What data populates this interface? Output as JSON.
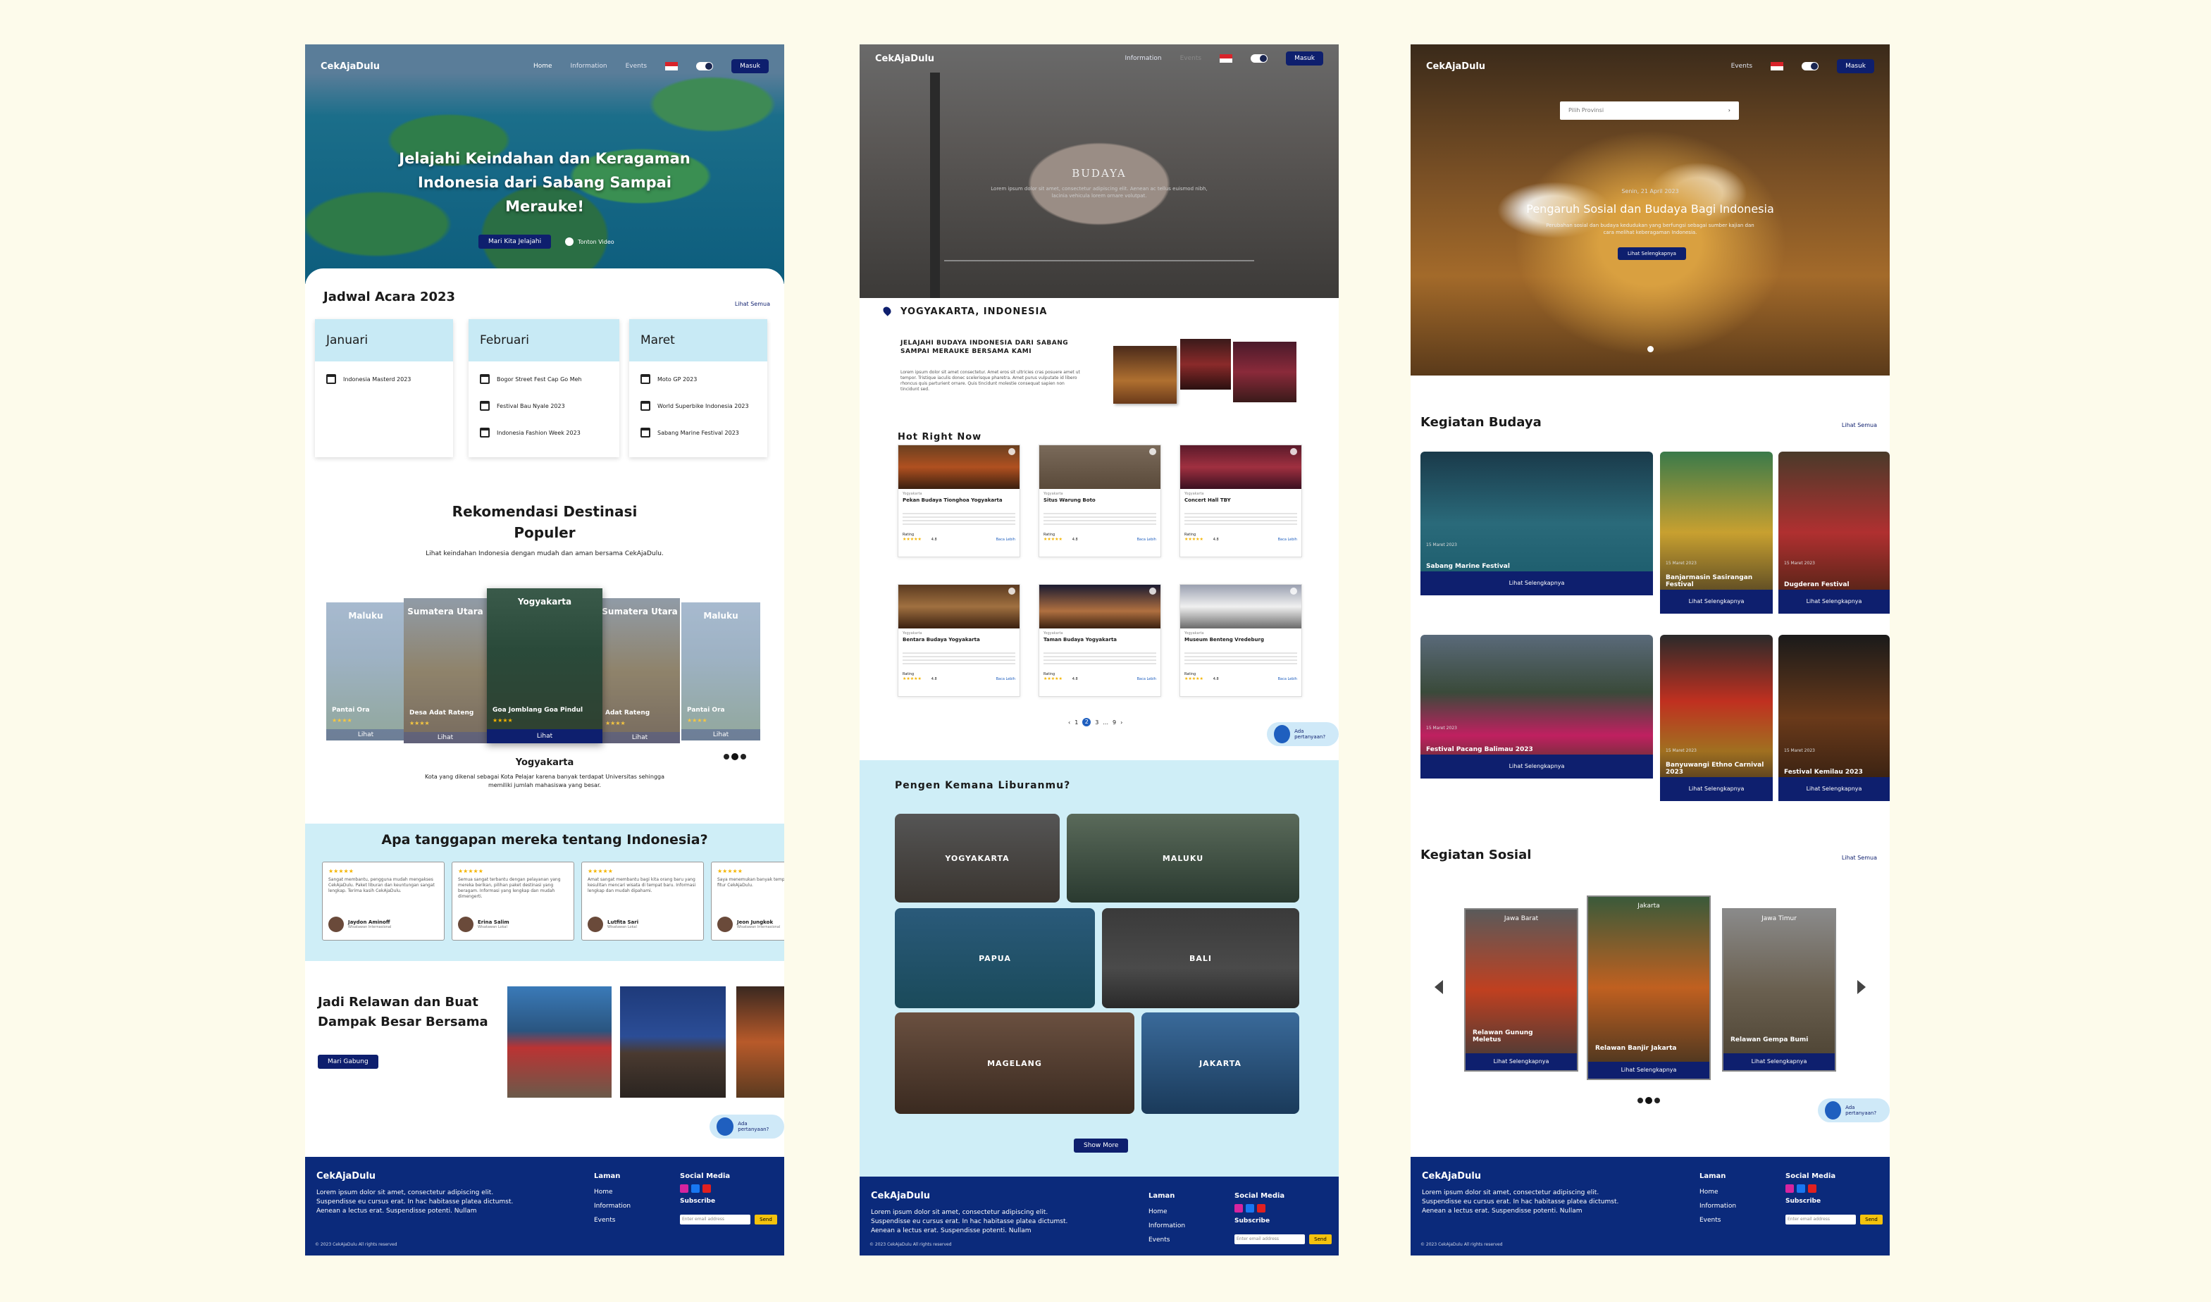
{
  "page1": {
    "nav": {
      "brand": "CekAjaDulu",
      "links": [
        "Home",
        "Information",
        "Events"
      ],
      "login": "Masuk"
    },
    "hero": {
      "title": "Jelajahi Keindahan dan Keragaman Indonesia dari Sabang Sampai Merauke!",
      "cta": "Mari Kita Jelajahi",
      "video": "Tonton Video"
    },
    "schedule": {
      "title": "Jadwal Acara 2023",
      "see_all": "Lihat Semua",
      "months": [
        {
          "name": "Januari",
          "events": [
            "Indonesia Masterd 2023"
          ]
        },
        {
          "name": "Februari",
          "events": [
            "Bogor Street Fest Cap Go Meh",
            "Festival Bau Nyale 2023",
            "Indonesia Fashion Week 2023"
          ]
        },
        {
          "name": "Maret",
          "events": [
            "Moto GP 2023",
            "World Superbike Indonesia 2023",
            "Sabang Marine Festival 2023"
          ]
        }
      ]
    },
    "reco": {
      "title": "Rekomendasi Destinasi Populer",
      "subtitle": "Lihat keindahan Indonesia dengan mudah dan aman bersama CekAjaDulu.",
      "cards": [
        {
          "region": "Maluku",
          "name": "Pantai Ora",
          "btn": "Lihat"
        },
        {
          "region": "Sumatera Utara",
          "name": "Desa Adat Rateng",
          "btn": "Lihat"
        },
        {
          "region": "Yogyakarta",
          "name": "Goa Jomblang Goa Pindul",
          "btn": "Lihat"
        },
        {
          "region": "Sumatera Utara",
          "name": "Adat Rateng",
          "btn": "Lihat"
        },
        {
          "region": "Maluku",
          "name": "Pantai Ora",
          "btn": "Lihat"
        }
      ],
      "selected": "Yogyakarta",
      "desc": "Kota yang dikenal sebagai Kota Pelajar karena banyak terdapat Universitas sehingga memiliki jumlah mahasiswa yang besar."
    },
    "testimonials": {
      "title": "Apa tanggapan mereka tentang Indonesia?",
      "items": [
        {
          "text": "Sangat membantu, pengguna mudah mengakses CekAjaDulu. Paket liburan dan keuntungan sangat lengkap. Terima kasih CekAjaDulu.",
          "name": "Jaydon Aminoff",
          "role": "Wisatawan Internasional"
        },
        {
          "text": "Semua sangat terbantu dengan pelayanan yang mereka berikan, pilihan paket destinasi yang beragam. Informasi yang lengkap dan mudah dimengerti.",
          "name": "Erina Salim",
          "role": "Wisatawan Lokal"
        },
        {
          "text": "Amat sangat membantu bagi kita orang baru yang kesulitan mencari wisata di tempat baru. Informasi lengkap dan mudah dipahami.",
          "name": "Lutfita Sari",
          "role": "Wisatawan Lokal"
        },
        {
          "text": "Saya menemukan banyak tempat menggunakan fitur CekAjaDulu.",
          "name": "Jeon Jungkok",
          "role": "Wisatawan Internasional"
        }
      ]
    },
    "volunteer": {
      "title": "Jadi Relawan dan Buat Dampak Besar Bersama",
      "cta": "Mari Gabung"
    },
    "chat": "Ada pertanyaan?",
    "footer": {
      "brand": "CekAjaDulu",
      "desc": "Lorem ipsum dolor sit amet, consectetur adipiscing elit. Suspendisse eu cursus erat. In hac habitasse platea dictumst. Aenean a lectus erat. Suspendisse potenti. Nullam",
      "lam_title": "Laman",
      "lam": [
        "Home",
        "Information",
        "Events"
      ],
      "social": "Social Media",
      "subscribe": "Subscribe",
      "email": "Enter email address",
      "send": "Send",
      "copy": "© 2023 CekAjaDulu All rights reserved"
    }
  },
  "page2": {
    "nav": {
      "brand": "CekAjaDulu",
      "links": [
        "Information",
        "Events"
      ],
      "login": "Masuk"
    },
    "hero": {
      "title": "BUDAYA",
      "text": "Lorem ipsum dolor sit amet, consectetur adipiscing elit. Aenean ac tellus euismod nibh, lacinia vehicula lorem ornare volutpat."
    },
    "location": "YOGYAKARTA, INDONESIA",
    "intro": {
      "title": "JELAJAHI BUDAYA INDONESIA DARI SABANG SAMPAI MERAUKE BERSAMA KAMI",
      "text": "Lorem ipsum dolor sit amet consectetur. Amet eros sit ultricies cras posuere amet ut tempor. Tristique iaculis donec scelerisque pharetra. Amet purus vulputate id libero rhoncus quis parturient ornare. Quis tincidunt molestie consequat sapien non tincidunt sed."
    },
    "hot": {
      "title": "Hot Right Now",
      "rating": "Rating",
      "more": "Baca Lebih",
      "items": [
        {
          "tag": "Yogyakarta",
          "name": "Pekan Budaya Tionghoa Yogyakarta",
          "score": "4.8"
        },
        {
          "tag": "Yogyakarta",
          "name": "Situs Warung Boto",
          "score": "4.8"
        },
        {
          "tag": "Yogyakarta",
          "name": "Concert Hall TBY",
          "score": "4.8"
        },
        {
          "tag": "Yogyakarta",
          "name": "Bentara Budaya Yogyakarta",
          "score": "4.8"
        },
        {
          "tag": "Yogyakarta",
          "name": "Taman Budaya Yogyakarta",
          "score": "4.8"
        },
        {
          "tag": "Yogyakarta",
          "name": "Museum Benteng Vredeburg",
          "score": "4.8"
        }
      ]
    },
    "pages": [
      "1",
      "2",
      "3",
      "...",
      "9"
    ],
    "where": {
      "title": "Pengen Kemana Liburanmu?",
      "places": [
        "YOGYAKARTA",
        "MALUKU",
        "PAPUA",
        "BALI",
        "MAGELANG",
        "JAKARTA"
      ],
      "more": "Show More"
    },
    "chat": "Ada pertanyaan?",
    "footer": {
      "brand": "CekAjaDulu",
      "desc": "Lorem ipsum dolor sit amet, consectetur adipiscing elit. Suspendisse eu cursus erat. In hac habitasse platea dictumst. Aenean a lectus erat. Suspendisse potenti. Nullam",
      "lam_title": "Laman",
      "lam": [
        "Home",
        "Information",
        "Events"
      ],
      "social": "Social Media",
      "subscribe": "Subscribe",
      "email": "Enter email address",
      "send": "Send",
      "copy": "© 2023 CekAjaDulu All rights reserved"
    }
  },
  "page3": {
    "nav": {
      "brand": "CekAjaDulu",
      "links": [
        "Events"
      ],
      "login": "Masuk"
    },
    "select": "Pilih Provinsi",
    "hero": {
      "date": "Senin, 21 April 2023",
      "title": "Pengaruh Sosial dan Budaya Bagi Indonesia",
      "text": "Perubahan sosial dan budaya kedudukan yang berfungsi sebagai sumber kajian dan cara melihat keberagaman Indonesia.",
      "cta": "Lihat Selengkapnya"
    },
    "budaya": {
      "title": "Kegiatan Budaya",
      "see_all": "Lihat Semua",
      "more": "Lihat Selengkapnya",
      "items": [
        {
          "date": "15 Maret 2023",
          "name": "Sabang Marine Festival"
        },
        {
          "date": "15 Maret 2023",
          "name": "Banjarmasin Sasirangan Festival"
        },
        {
          "date": "15 Maret 2023",
          "name": "Dugderan Festival"
        },
        {
          "date": "15 Maret 2023",
          "name": "Festival Pacang Balimau 2023"
        },
        {
          "date": "15 Maret 2023",
          "name": "Banyuwangi Ethno Carnival 2023"
        },
        {
          "date": "15 Maret 2023",
          "name": "Festival Kemilau 2023"
        }
      ]
    },
    "sosial": {
      "title": "Kegiatan Sosial",
      "see_all": "Lihat Semua",
      "more": "Lihat Selengkapnya",
      "items": [
        {
          "region": "Jawa Barat",
          "name": "Relawan Gunung Meletus"
        },
        {
          "region": "Jakarta",
          "name": "Relawan Banjir Jakarta"
        },
        {
          "region": "Jawa Timur",
          "name": "Relawan Gempa Bumi"
        }
      ]
    },
    "chat": "Ada pertanyaan?",
    "footer": {
      "brand": "CekAjaDulu",
      "desc": "Lorem ipsum dolor sit amet, consectetur adipiscing elit. Suspendisse eu cursus erat. In hac habitasse platea dictumst. Aenean a lectus erat. Suspendisse potenti. Nullam",
      "lam_title": "Laman",
      "lam": [
        "Home",
        "Information",
        "Events"
      ],
      "social": "Social Media",
      "subscribe": "Subscribe",
      "email": "Enter email address",
      "send": "Send",
      "copy": "© 2023 CekAjaDulu All rights reserved"
    }
  },
  "colors": {
    "navy": "#0e1f6e",
    "footer": "#0b2a7b",
    "accent": "#c8eaf5",
    "star": "#f4b400",
    "bg": "#fdfbeb"
  }
}
